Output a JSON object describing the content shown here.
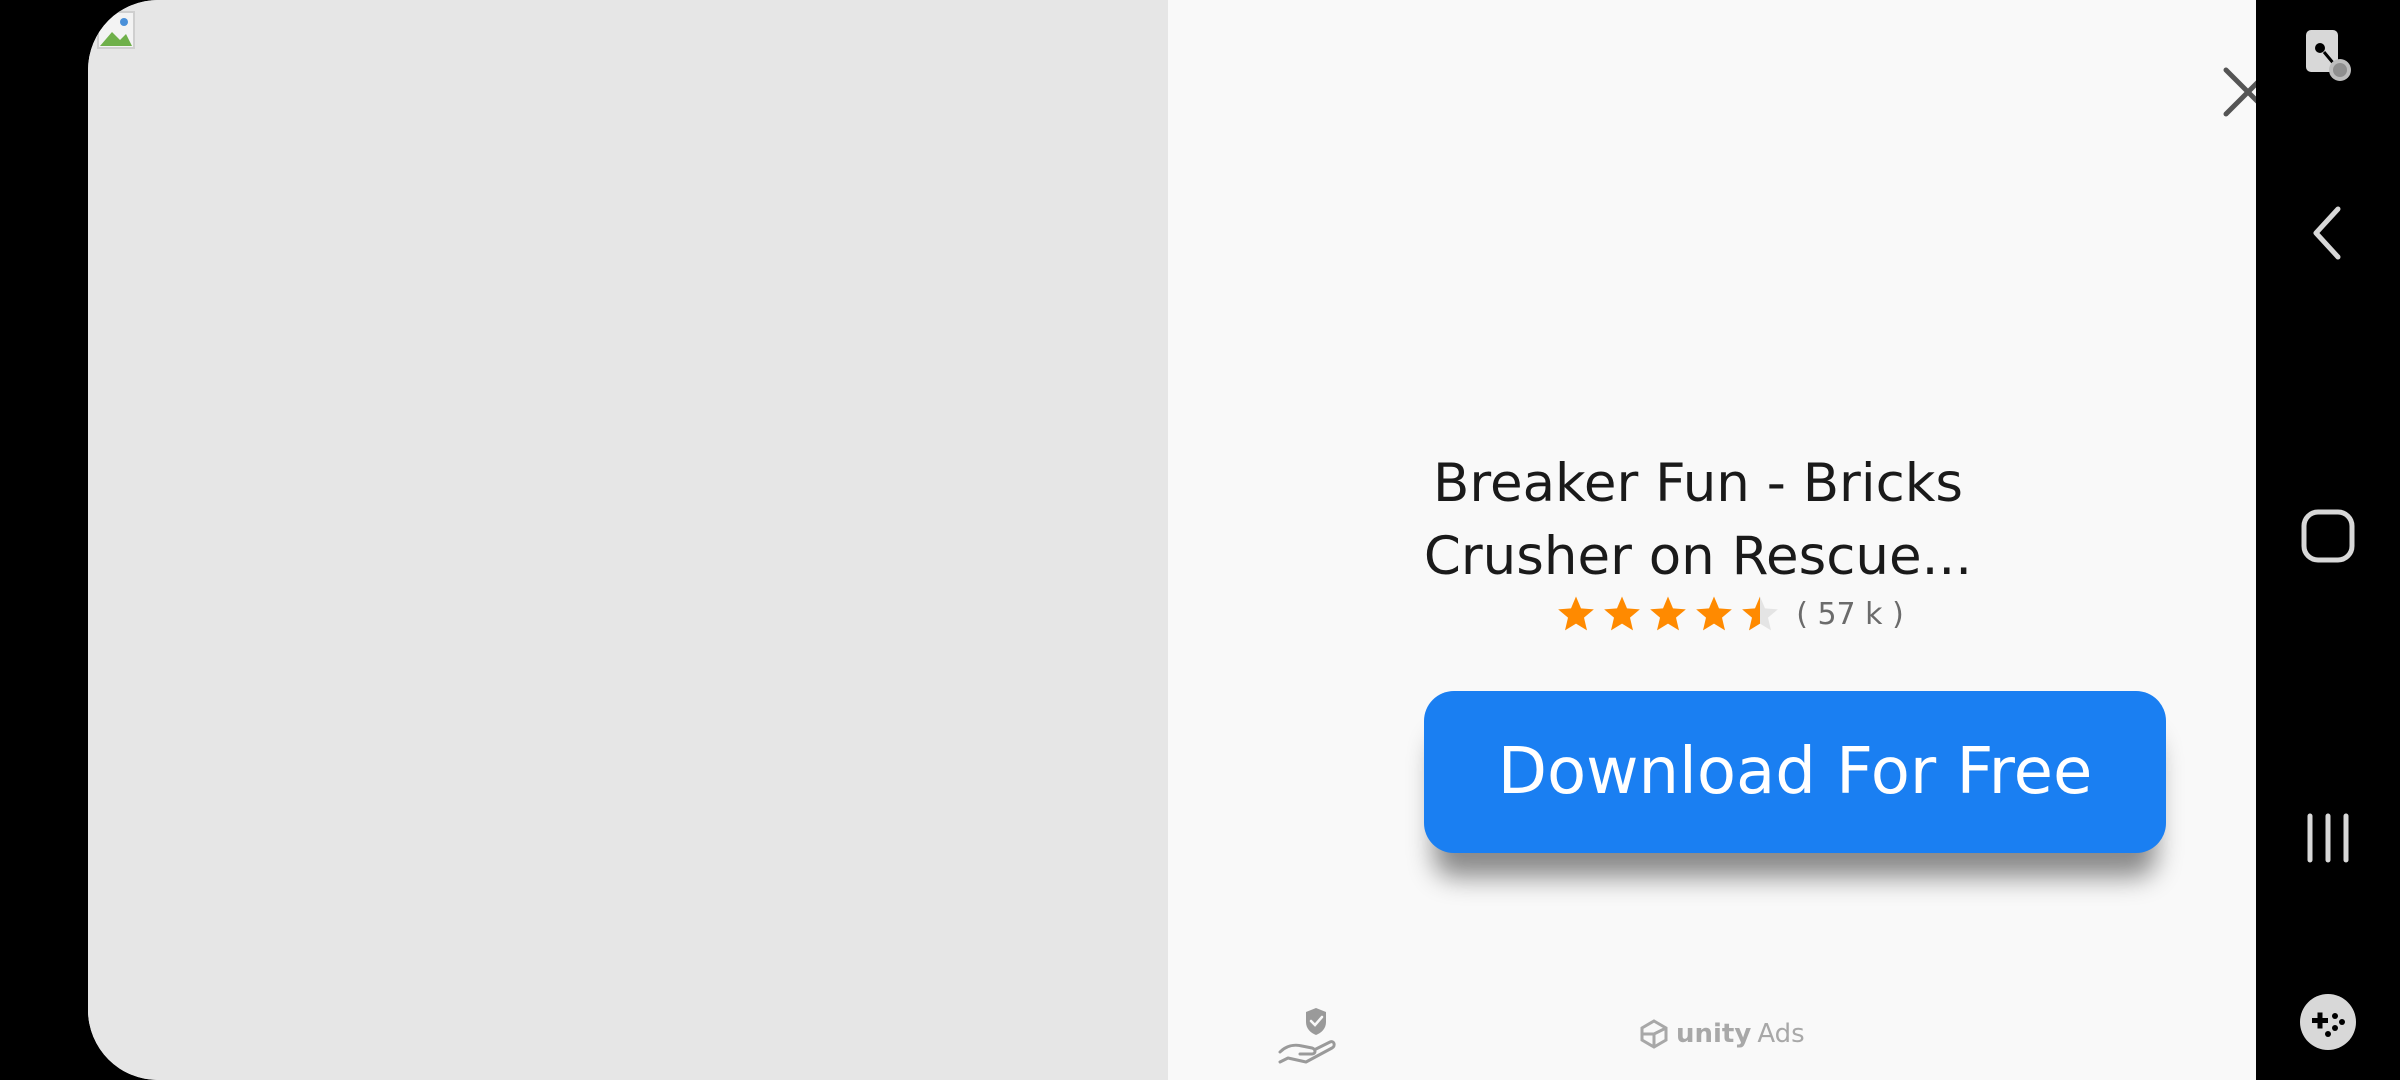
{
  "ad": {
    "app_title": "Breaker Fun - Bricks\n Crusher on Rescue...",
    "rating_stars": 4.5,
    "rating_count": "( 57 k )",
    "cta_label": "Download For Free",
    "brand_name": "unity",
    "brand_suffix": "Ads",
    "icons": {
      "close": "close-icon",
      "privacy": "privacy-shield-hand-icon",
      "broken_image": "broken-image-icon",
      "brand_logo": "unity-logo-icon"
    },
    "colors": {
      "cta_background": "#1a7ff2",
      "star": "#ff8a00",
      "media_panel": "#e6e6e6",
      "info_panel": "#f9f9f9"
    }
  },
  "navbar": {
    "items": [
      {
        "name": "screenshot-edit",
        "icon": "screen-capture-icon"
      },
      {
        "name": "back",
        "icon": "back-chevron-icon"
      },
      {
        "name": "home",
        "icon": "home-square-icon"
      },
      {
        "name": "recents",
        "icon": "recents-bars-icon"
      },
      {
        "name": "game-tools",
        "icon": "game-controller-icon"
      }
    ]
  }
}
